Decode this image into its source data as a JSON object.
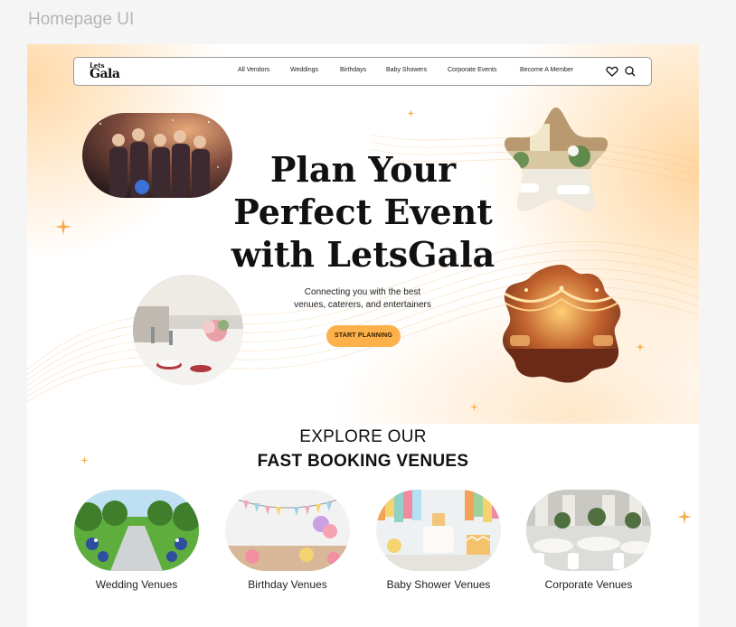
{
  "frame_title": "Homepage UI",
  "brand": {
    "logo_line1": "Lets",
    "logo_line2": "Gala"
  },
  "nav": {
    "items": [
      "All Vendors",
      "Weddings",
      "Birthdays",
      "Baby Showers",
      "Corporate Events",
      "Become A Member"
    ],
    "icons": [
      "heart-icon",
      "search-icon"
    ]
  },
  "hero": {
    "title_lines": [
      "Plan Your",
      "Perfect Event",
      "with LetsGala"
    ],
    "subtitle_lines": [
      "Connecting you with the best",
      "venues, caterers, and entertainers"
    ],
    "cta_label": "START PLANNING",
    "photos": [
      "party-crowd-photo",
      "table-setting-photo",
      "hall-interior-photo",
      "lit-ballroom-photo"
    ]
  },
  "section": {
    "heading_line1": "EXPLORE OUR",
    "heading_line2": "FAST BOOKING VENUES"
  },
  "venues": [
    {
      "label": "Wedding Venues"
    },
    {
      "label": "Birthday Venues"
    },
    {
      "label": "Baby Shower Venues"
    },
    {
      "label": "Corporate Venues"
    }
  ],
  "colors": {
    "accent": "#fcb14b",
    "sparkle": "#f6a94a",
    "text": "#111111"
  }
}
